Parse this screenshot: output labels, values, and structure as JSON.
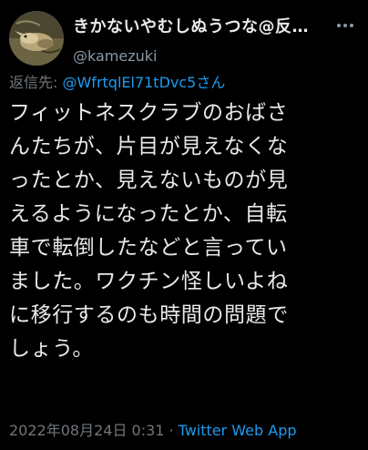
{
  "author": {
    "display_name": "きかないやむしぬうつな@反…",
    "handle": "@kamezuki",
    "avatar_icon": "bird-avatar-icon"
  },
  "reply": {
    "prefix": "返信先: ",
    "handle": "@WfrtqlEl71tDvc5",
    "suffix": "さん"
  },
  "body": {
    "lines": [
      "フィットネスクラブのおばさ",
      "んたちが、片目が見えなくな",
      "ったとか、見えないものが見",
      "えるようになったとか、自転",
      "車で転倒したなどと言ってい",
      "ました。ワクチン怪しいよね",
      "に移行するのも時間の問題で",
      "しょう。"
    ]
  },
  "meta": {
    "timestamp": "2022年08月24日 0:31",
    "separator": "·",
    "source_app": "Twitter Web App"
  },
  "colors": {
    "background": "#000000",
    "text": "#e7e9ea",
    "secondary": "#71767b",
    "link": "#1d9bf0"
  }
}
